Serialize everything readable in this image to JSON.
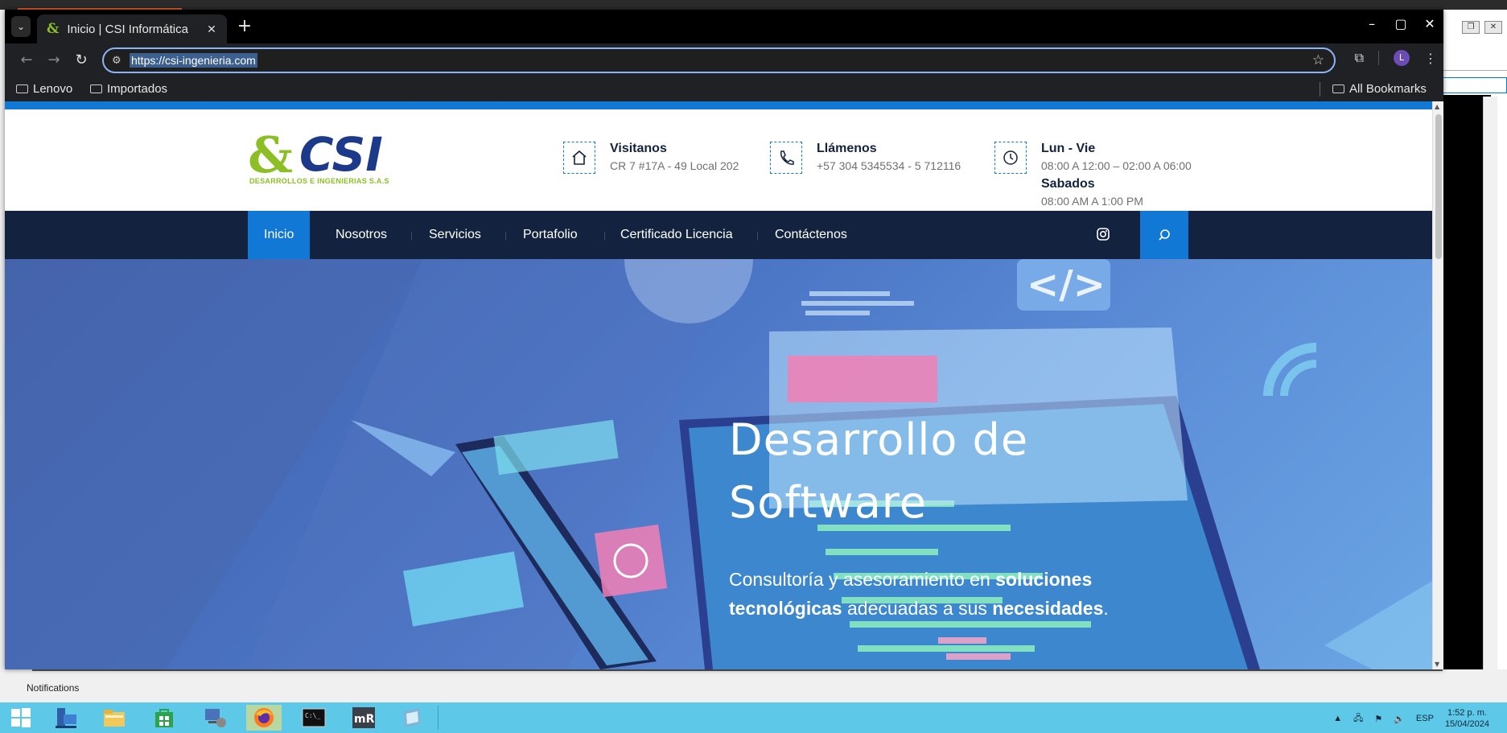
{
  "browser": {
    "tab_title": "Inicio | CSI Informática",
    "url": "https://csi-ingenieria.com",
    "avatar_letter": "L",
    "bookmarks": [
      {
        "label": "Lenovo"
      },
      {
        "label": "Importados"
      }
    ],
    "all_bookmarks_label": "All Bookmarks"
  },
  "site": {
    "logo_text": "CSI",
    "logo_sub": "DESARROLLOS E INGENIERIAS S.A.S",
    "info": {
      "visit_title": "Visitanos",
      "visit_address": "CR 7 #17A - 49 Local 202",
      "call_title": "Llámenos",
      "call_phone": "+57 304 5345534 - 5 712116",
      "hours_title": "Lun - Vie",
      "hours_weekday": "08:00 A 12:00 – 02:00 A 06:00",
      "hours_sat_title": "Sabados",
      "hours_sat": "08:00 AM A 1:00 PM"
    },
    "nav": [
      {
        "label": "Inicio",
        "active": true
      },
      {
        "label": "Nosotros"
      },
      {
        "label": "Servicios"
      },
      {
        "label": "Portafolio"
      },
      {
        "label": "Certificado Licencia"
      },
      {
        "label": "Contáctenos"
      }
    ],
    "hero": {
      "title_line1": "Desarrollo de",
      "title_line2": "Software",
      "sub_part1": "Consultoría y asesoramiento en ",
      "sub_bold1": "soluciones tecnológicas",
      "sub_part2": " adecuadas a sus ",
      "sub_bold2": "necesidades",
      "sub_end": "."
    },
    "colors": {
      "accent": "#1178d6",
      "nav_bg": "#13233f",
      "logo_green": "#8cbf26",
      "logo_blue": "#1d3a8a"
    }
  },
  "desktop": {
    "notifications_label": "Notifications",
    "tray": {
      "language": "ESP",
      "time": "1:52 p. m.",
      "date": "15/04/2024"
    },
    "taskbar_items": [
      "start-icon",
      "server-manager-icon",
      "file-explorer-icon",
      "store-icon",
      "network-icon",
      "firefox-icon",
      "terminal-icon",
      "mremoteng-icon",
      "app-icon"
    ]
  }
}
